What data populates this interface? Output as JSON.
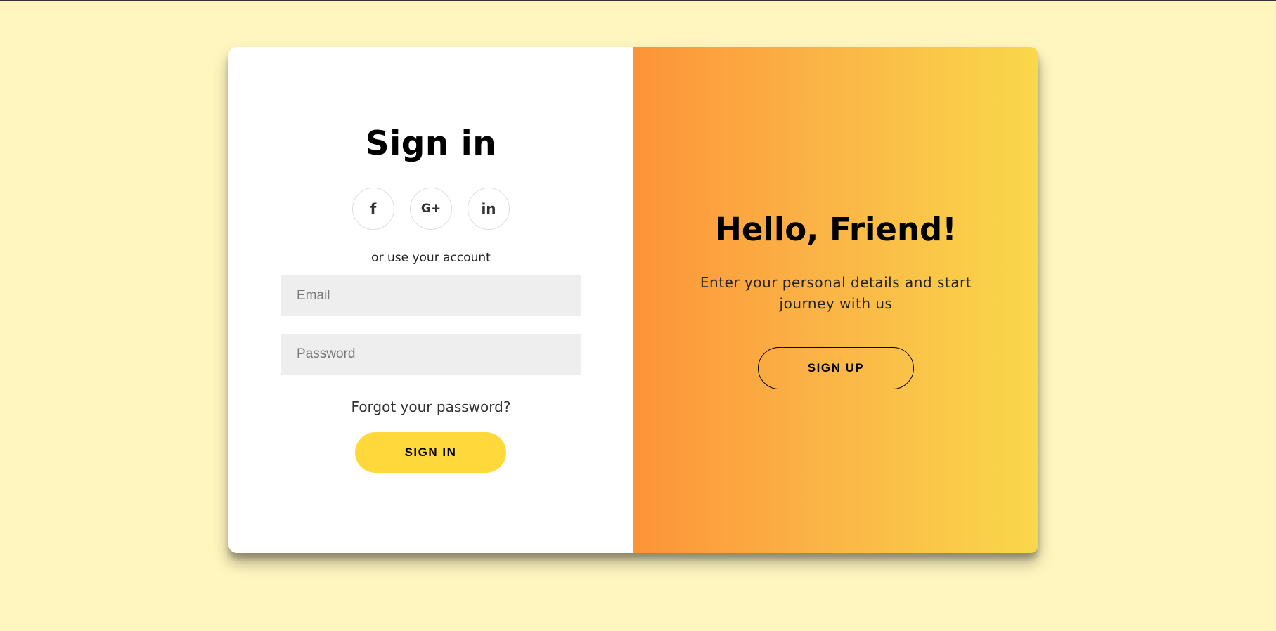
{
  "signin": {
    "title": "Sign in",
    "social": {
      "facebook": "f",
      "google": "G+",
      "linkedin": "in"
    },
    "alt_text": "or use your account",
    "email_placeholder": "Email",
    "password_placeholder": "Password",
    "forgot": "Forgot your password?",
    "button": "SIGN IN"
  },
  "overlay": {
    "title": "Hello, Friend!",
    "text": "Enter your personal details and start journey with us",
    "button": "SIGN UP"
  },
  "colors": {
    "background": "#fff5bf",
    "signin_button": "#ffd93b",
    "gradient_start": "#fc9438",
    "gradient_end": "#f9d84a"
  }
}
